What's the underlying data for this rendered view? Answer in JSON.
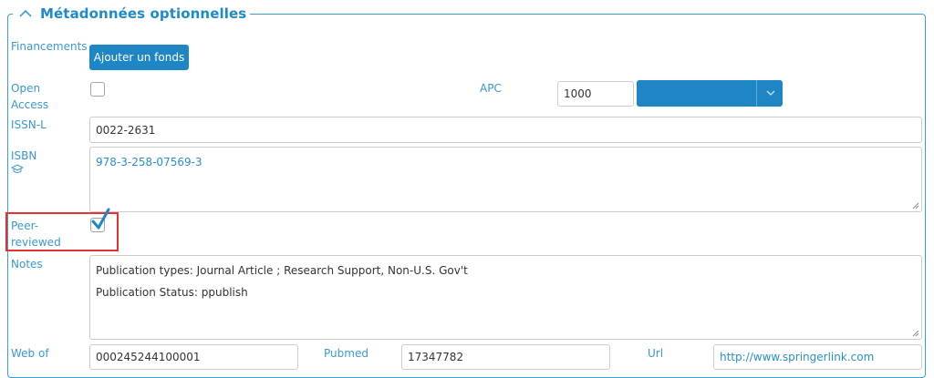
{
  "section": {
    "title": "Métadonnées optionnelles"
  },
  "funding": {
    "label": "Financements",
    "button": "Ajouter un fonds"
  },
  "open_access": {
    "label_line1": "Open",
    "label_line2": "Access",
    "checked": false
  },
  "apc": {
    "label": "APC",
    "amount": "1000",
    "currency": ""
  },
  "issn_l": {
    "label": "ISSN-L",
    "value": "0022-2631"
  },
  "isbn": {
    "label": "ISBN",
    "icon": "graduation-cap-icon",
    "value": "978-3-258-07569-3"
  },
  "peer_reviewed": {
    "label_line1": "Peer-",
    "label_line2": "reviewed",
    "checked": true
  },
  "notes": {
    "label": "Notes",
    "lines": [
      "Publication types: Journal Article ; Research Support, Non-U.S. Gov't",
      "Publication Status: ppublish"
    ]
  },
  "web_of_science": {
    "label": "Web of",
    "value": "000245244100001"
  },
  "pubmed": {
    "label": "Pubmed",
    "value": "17347782"
  },
  "url": {
    "label": "Url",
    "value": "http://www.springerlink.com"
  },
  "colors": {
    "accent": "#1e86c4",
    "label": "#3a98cf",
    "highlight": "#e53333"
  }
}
